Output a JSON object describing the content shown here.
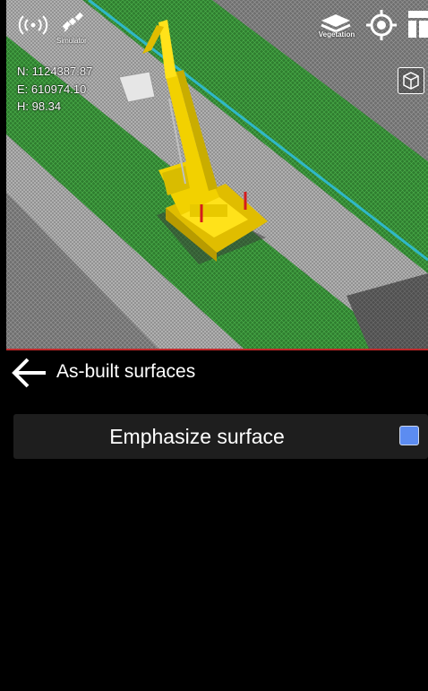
{
  "viewport": {
    "simulator_label": "Simulator",
    "vegetation_label": "Vegetation",
    "coordinates": {
      "north": "N: 1124387.87",
      "east": "E: 610974.10",
      "height": "H: 98.34"
    },
    "icons": {
      "connection": "wireless-signal-icon",
      "satellite": "satellite-icon",
      "layers": "layers-icon",
      "locate": "locate-target-icon",
      "menu": "panel-menu-icon",
      "view_cube": "3d-cube-icon"
    }
  },
  "panel": {
    "back_icon": "arrow-left-icon",
    "title": "As-built surfaces",
    "option": {
      "label": "Emphasize surface",
      "checked": true,
      "checkbox_color": "#5c8cf1"
    }
  },
  "colors": {
    "accent_divider": "#c0282a",
    "machine_yellow": "#f2d100",
    "surface_green": "#2e8a2e",
    "design_line_cyan": "#2fb8c8"
  }
}
